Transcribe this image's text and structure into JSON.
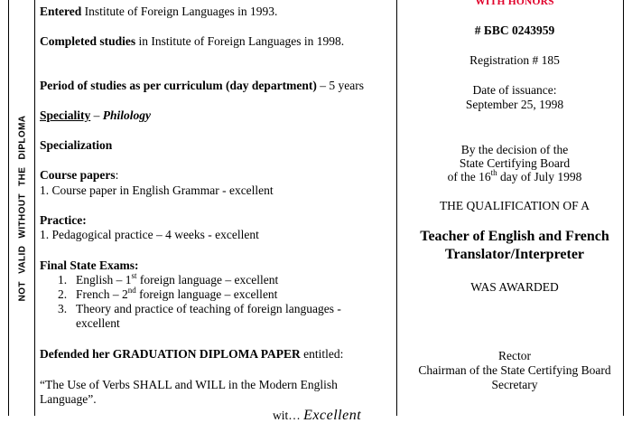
{
  "side_label": "NOT VALID WITHOUT THE DIPLOMA",
  "left": {
    "entered": {
      "bold": "Entered",
      "rest": " Institute of Foreign Languages in 1993."
    },
    "completed": {
      "bold": "Completed studies",
      "rest": " in Institute of Foreign Languages in 1998."
    },
    "period": {
      "bold": "Period of studies as per curriculum (day department)",
      "rest": " – 5 years"
    },
    "speciality": {
      "label": "Speciality",
      "dash": " – ",
      "value": "Philology"
    },
    "specialization": "Specialization",
    "course_papers": {
      "title": "Course papers",
      "colon": ":",
      "item": "1. Course paper in English Grammar - excellent"
    },
    "practice": {
      "title": "Practice:",
      "item": "1. Pedagogical practice – 4 weeks - excellent"
    },
    "final_exams": {
      "title": "Final State Exams:",
      "items": [
        {
          "num": "1.",
          "pre": "English – 1",
          "sup": "st",
          "post": " foreign language – excellent"
        },
        {
          "num": "2.",
          "pre": "French – 2",
          "sup": "nd",
          "post": " foreign language – excellent"
        },
        {
          "num": "3.",
          "text1": "Theory and practice of teaching of foreign languages -",
          "text2": "excellent"
        }
      ]
    },
    "defended": {
      "bold": "Defended her GRADUATION DIPLOMA PAPER",
      "rest": " entitled:"
    },
    "paper_title": {
      "line1": "“The Use of Verbs SHALL and WILL in the Modern English",
      "line2": "Language”."
    },
    "cut_text": {
      "partial": "wit… ",
      "grade": "Excellent"
    }
  },
  "right": {
    "honors": "WITH HONORS",
    "number": "# БВС 0243959",
    "registration": "Registration # 185",
    "date_label": "Date of issuance:",
    "date_value": "September 25, 1998",
    "decision": {
      "line1": "By the decision of the",
      "line2": "State Certifying Board",
      "line3_pre": "of the 16",
      "line3_sup": "th",
      "line3_post": " day of July 1998"
    },
    "qualification_label": "THE QUALIFICATION OF A",
    "qualification": {
      "line1": "Teacher of English and French",
      "line2": "Translator/Interpreter"
    },
    "awarded": "WAS AWARDED",
    "rector": "Rector",
    "chairman": "Chairman of the State Certifying Board",
    "secretary": "Secretary"
  }
}
